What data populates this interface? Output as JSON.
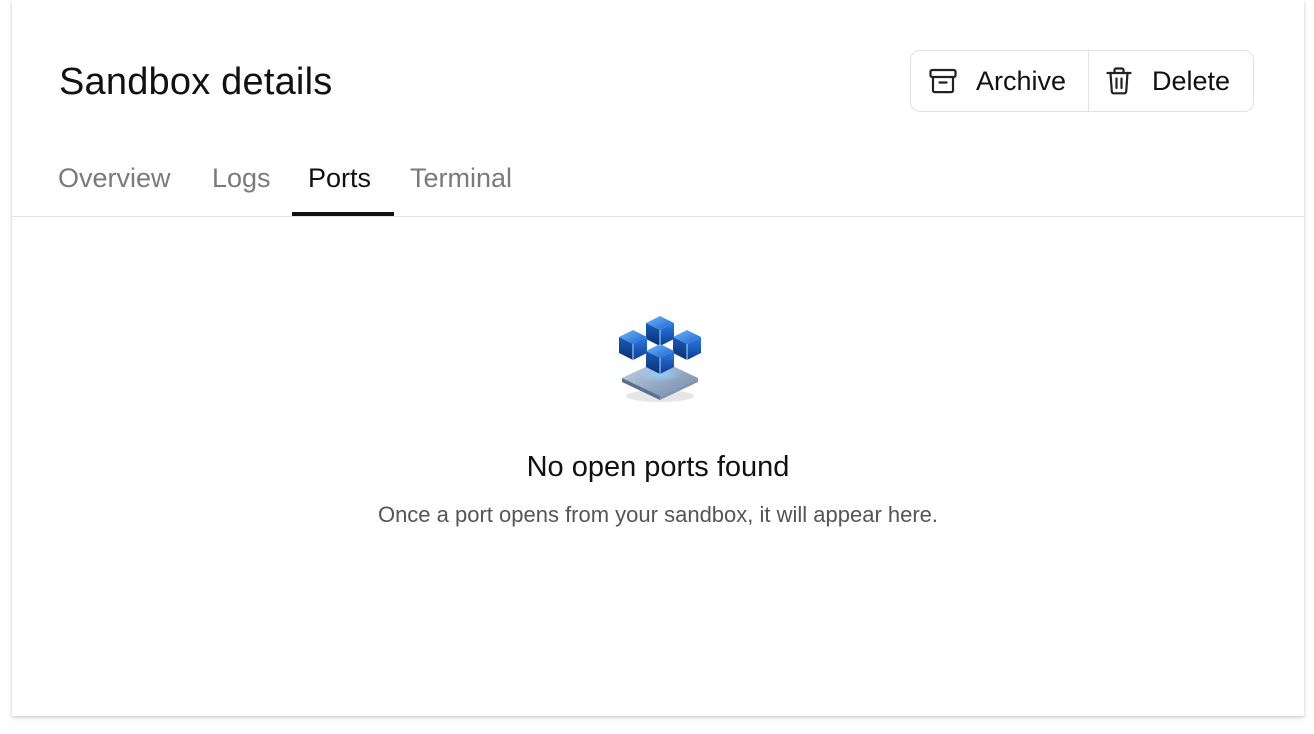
{
  "page": {
    "title": "Sandbox details"
  },
  "actions": {
    "archive": {
      "label": "Archive",
      "icon": "archive-icon"
    },
    "delete": {
      "label": "Delete",
      "icon": "trash-icon"
    }
  },
  "tabs": [
    {
      "label": "Overview",
      "active": false
    },
    {
      "label": "Logs",
      "active": false
    },
    {
      "label": "Ports",
      "active": true
    },
    {
      "label": "Terminal",
      "active": false
    }
  ],
  "empty_state": {
    "icon": "cubes-icon",
    "title": "No open ports found",
    "subtitle": "Once a port opens from your sandbox, it will appear here."
  },
  "colors": {
    "accent_blue": "#1e7bff",
    "text_primary": "#111111",
    "text_muted": "#7a7a7a",
    "border": "#e2e2e2"
  }
}
